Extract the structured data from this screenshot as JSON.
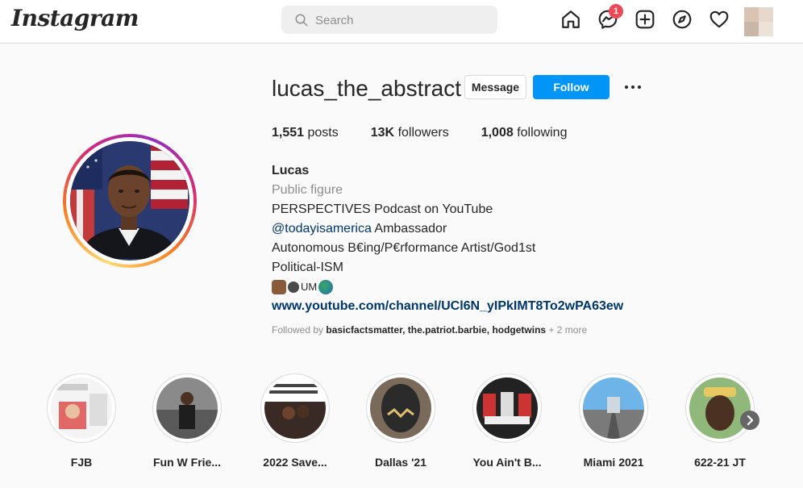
{
  "header": {
    "logo": "Instagram",
    "search_placeholder": "Search",
    "messages_badge": "1",
    "icons": [
      "home-icon",
      "messenger-icon",
      "new-post-icon",
      "explore-icon",
      "activity-heart-icon"
    ]
  },
  "profile": {
    "username": "lucas_the_abstract",
    "message_label": "Message",
    "follow_label": "Follow",
    "stats": {
      "posts_count": "1,551",
      "posts_label": "posts",
      "followers_count": "13K",
      "followers_label": "followers",
      "following_count": "1,008",
      "following_label": "following"
    },
    "bio": {
      "name": "Lucas",
      "category": "Public figure",
      "line1": "PERSPECTIVES Podcast on YouTube",
      "mention": "@todayisamerica",
      "mention_suffix": "Ambassador",
      "line3": "Autonomous B€ing/P€rformance Artist/God1st",
      "line4": "Political-ISM",
      "emoji_text": "UM",
      "link": "www.youtube.com/channel/UCl6N_yIPkIMT8To2wPA63ew"
    },
    "followed_by_prefix": "Followed by",
    "followed_by_users": "basicfactsmatter, the.patriot.barbie, hodgetwins",
    "followed_by_more": "+ 2 more"
  },
  "highlights": [
    {
      "label": "FJB"
    },
    {
      "label": "Fun W Frie..."
    },
    {
      "label": "2022 Save..."
    },
    {
      "label": "Dallas '21"
    },
    {
      "label": "You Ain't B..."
    },
    {
      "label": "Miami 2021"
    },
    {
      "label": "622-21 JT"
    }
  ],
  "colors": {
    "accent": "#0095f6",
    "link": "#00376b",
    "badge": "#ed4956",
    "muted": "#8e8e8e"
  }
}
